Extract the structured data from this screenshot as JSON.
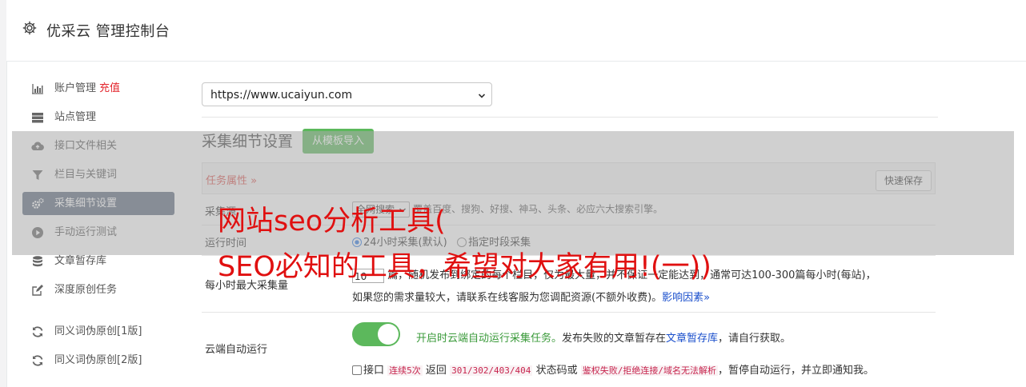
{
  "header": {
    "title": "优采云 管理控制台",
    "icon": "gear-icon"
  },
  "sidebar": {
    "items": [
      {
        "label": "账户管理",
        "badge": "充值",
        "icon": "bar-chart-icon",
        "active": false
      },
      {
        "label": "站点管理",
        "icon": "server-icon",
        "active": false
      },
      {
        "label": "接口文件相关",
        "icon": "cloud-upload-icon",
        "active": false
      },
      {
        "label": "栏目与关键词",
        "icon": "filter-icon",
        "active": false
      },
      {
        "label": "采集细节设置",
        "icon": "gears-icon",
        "active": true
      },
      {
        "label": "手动运行测试",
        "icon": "play-circle-icon",
        "active": false
      },
      {
        "label": "文章暂存库",
        "icon": "database-icon",
        "active": false
      },
      {
        "label": "深度原创任务",
        "icon": "edit-icon",
        "active": false
      }
    ],
    "items2": [
      {
        "label": "同义词伪原创[1版]",
        "icon": "refresh-icon"
      },
      {
        "label": "同义词伪原创[2版]",
        "icon": "refresh-icon"
      }
    ]
  },
  "main": {
    "site_select": "https://www.ucaiyun.com",
    "section_title": "采集细节设置",
    "import_button": "从模板导入",
    "task_header": "任务属性 »",
    "save_button": "快速保存",
    "rows": {
      "search": {
        "label": "采集源",
        "select_value": "全网搜索",
        "text": "覆盖百度、搜狗、好搜、神马、头条、必应六大搜索引擎。"
      },
      "runtime": {
        "label": "运行时间",
        "option1": "24小时采集(默认)",
        "option2": "指定时段采集"
      },
      "max": {
        "label": "每小时最大采集量",
        "value": "10",
        "line1": "篇，随机发布到绑定的每个栏目，仅为最大量，并不保证一定能达到，通常可达100-300篇每小时(每站)，",
        "line2": "如果您的需求量较大，请联系在线客服为您调配资源(不额外收费)。",
        "link": "影响因素»"
      },
      "cloud": {
        "label": "云端自动运行",
        "enabled_text": "开启时云端自动运行采集任务。",
        "desc1": "发布失败的文章暂存在",
        "link": "文章暂存库",
        "desc2": "，请自行获取。",
        "chk_label": "接口",
        "code1": "连续5次",
        "t1": "返回",
        "code2": "301/302/403/404",
        "t2": "状态码或",
        "code3": "鉴权失败/拒绝连接/域名无法解析",
        "t3": "，暂停自动运行，并立即通知我。"
      }
    }
  },
  "overlay": {
    "line1": "网站seo分析工具(",
    "line2": "SEO必知的工具，希望对大家有用!(一))"
  },
  "colors": {
    "accent": "#5cb85c",
    "active_nav": "#5d6a7e",
    "danger": "#d9534f",
    "overlay_text": "#e01010"
  }
}
